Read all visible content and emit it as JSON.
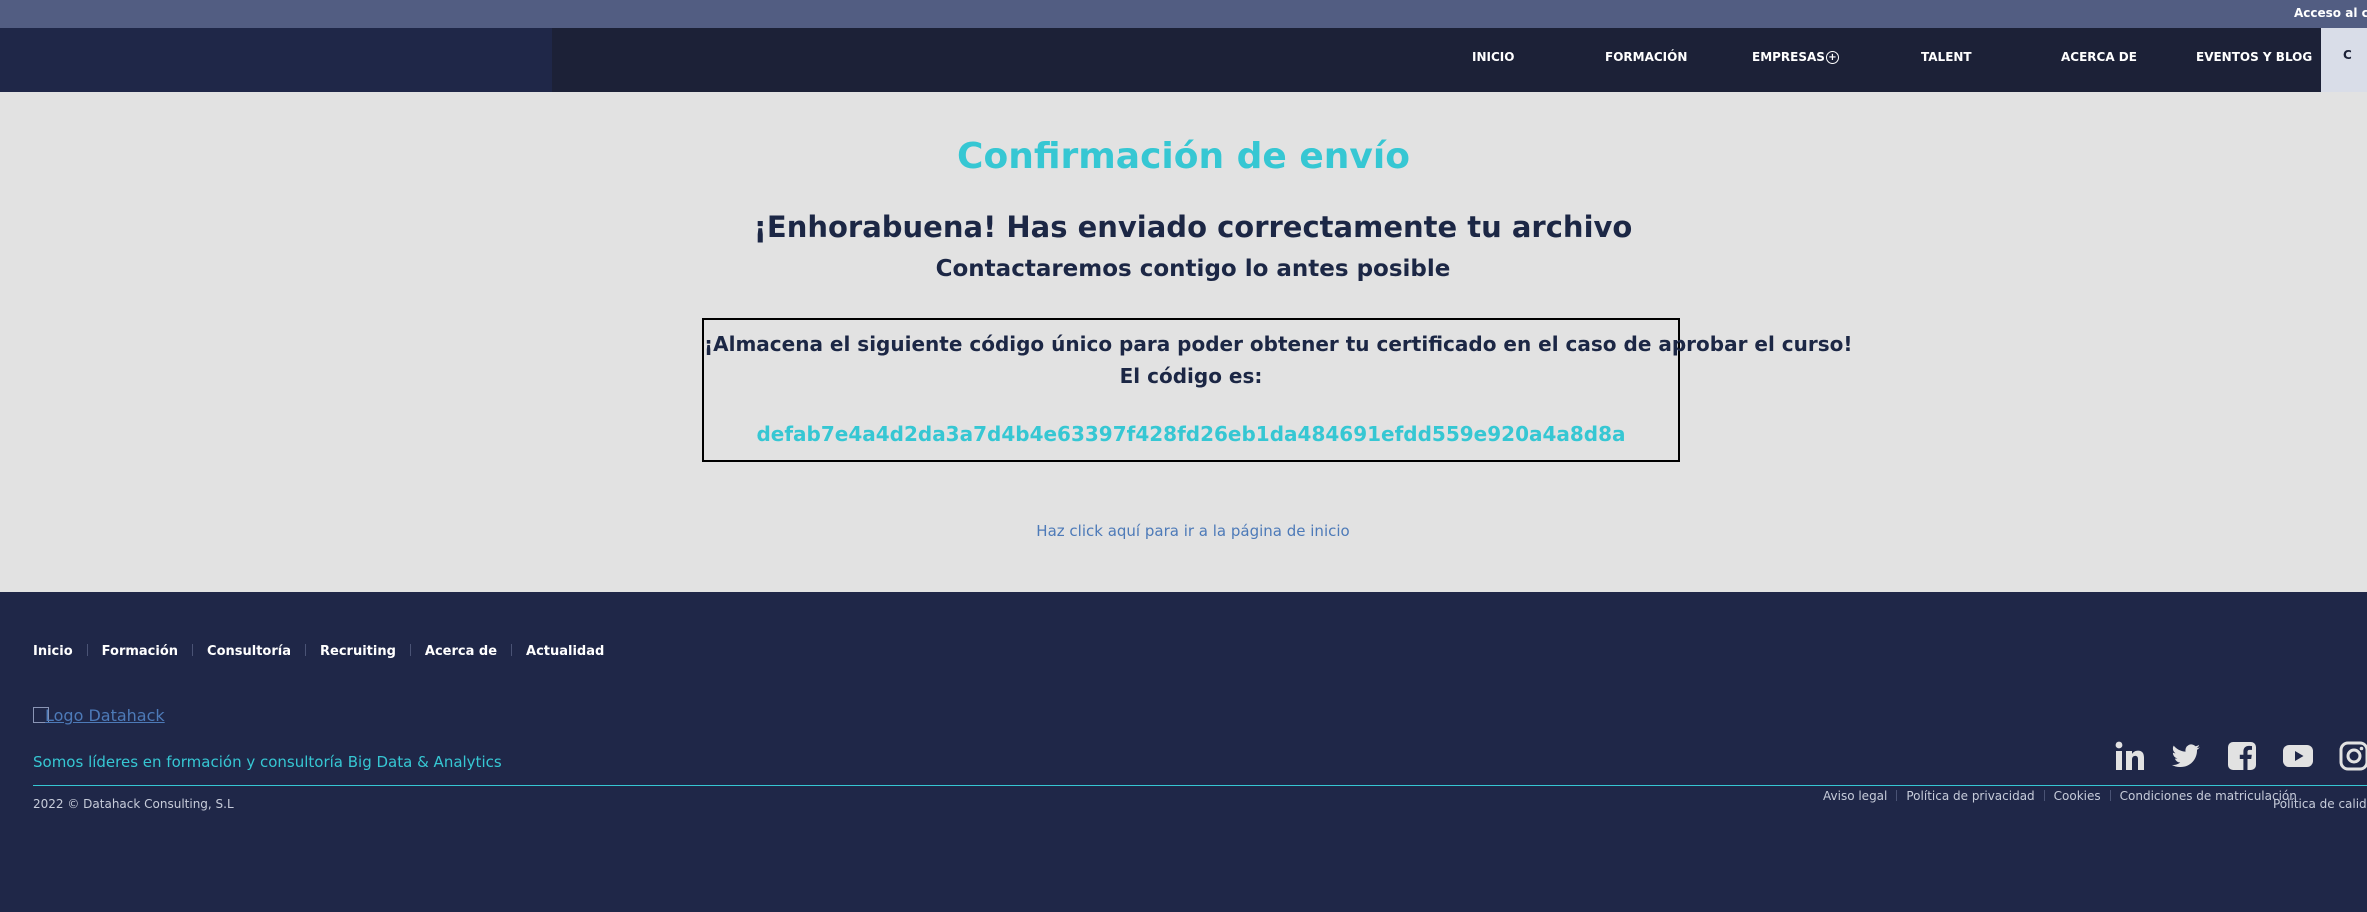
{
  "topbar": {
    "access_link": "Acceso al campus"
  },
  "nav": {
    "items": [
      {
        "label": "INICIO"
      },
      {
        "label": "FORMACIÓN"
      },
      {
        "label": "EMPRESAS"
      },
      {
        "label": "TALENT"
      },
      {
        "label": "ACERCA DE"
      },
      {
        "label": "EVENTOS Y BLOG"
      }
    ],
    "empresas_badge": "+",
    "right_button": "C"
  },
  "main": {
    "title": "Confirmación de envío",
    "congrats": "¡Enhorabuena! Has enviado correctamente tu archivo",
    "contact": "Contactaremos contigo lo antes posible",
    "code_store_text": "¡Almacena el siguiente código único para poder obtener tu certificado en el caso de aprobar el curso!",
    "code_label": "El código es:",
    "code_value": "defab7e4a4d2da3a7d4b4e63397f428fd26eb1da484691efdd559e920a4a8d8a",
    "home_link": "Haz click aquí para ir a la página de inicio"
  },
  "footer": {
    "nav": [
      {
        "label": "Inicio"
      },
      {
        "label": "Formación"
      },
      {
        "label": "Consultoría"
      },
      {
        "label": "Recruiting"
      },
      {
        "label": "Acerca de"
      },
      {
        "label": "Actualidad"
      }
    ],
    "logo_alt": "Logo Datahack",
    "tagline": "Somos líderes en formación y consultoría Big Data & Analytics",
    "copyright": "2022 © Datahack Consulting, S.L",
    "legal": [
      {
        "label": "Aviso legal"
      },
      {
        "label": "Política de privacidad"
      },
      {
        "label": "Cookies"
      },
      {
        "label": "Condiciones de matriculación"
      }
    ],
    "legal_extra": "Política de calidad",
    "social_icons": [
      "linkedin-icon",
      "twitter-icon",
      "facebook-icon",
      "youtube-icon",
      "instagram-icon"
    ]
  },
  "colors": {
    "accent": "#36c7d3",
    "navy": "#1f2748",
    "nav_dark": "#1c2137",
    "topbar": "#525d82",
    "page_bg": "#e2e2e2",
    "text_dark": "#1c2745",
    "link": "#4d7ab8"
  }
}
